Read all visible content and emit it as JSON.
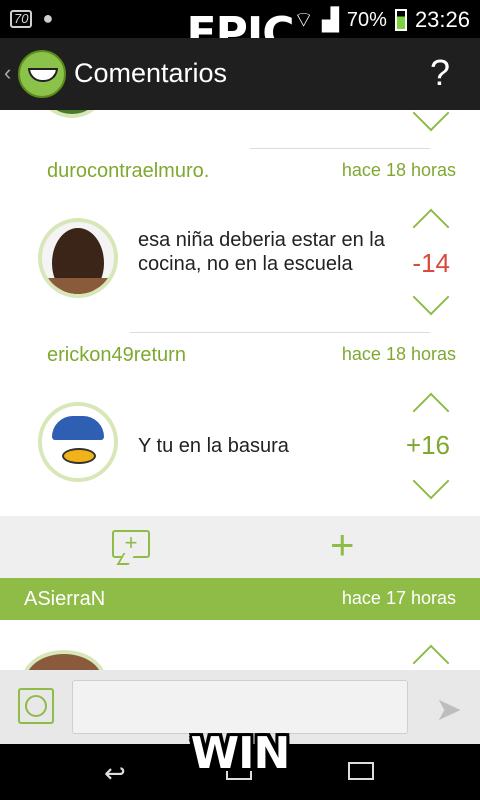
{
  "status_bar": {
    "badge": "70",
    "battery_percent": "70%",
    "time": "23:26"
  },
  "meme": {
    "top_text": "EPIC",
    "bottom_text": "WIN"
  },
  "action_bar": {
    "back_glyph": "‹",
    "title": "Comentarios",
    "help_glyph": "?"
  },
  "comments": [
    {
      "user": "durocontraelmuro.",
      "time": "hace 18 horas",
      "text": "esa niña deberia estar en la cocina, no en la escuela",
      "score": "-14",
      "avatar": "man-photo-avatar"
    },
    {
      "user": "erickon49return",
      "time": "hace 18 horas",
      "text": "Y tu en la basura",
      "score": "+16",
      "avatar": "duck-meme-avatar"
    }
  ],
  "thread_toolbar": {
    "comment_icon": "comment-add-icon",
    "add_icon": "plus-icon"
  },
  "next_thread": {
    "user": "ASierraN",
    "time": "hace 17 horas"
  },
  "input_bar": {
    "placeholder": "",
    "emoji_icon": "smiley-icon",
    "send_icon": "send-icon"
  },
  "colors": {
    "accent": "#8fbc47",
    "negative": "#d94a3d",
    "positive": "#7fa830",
    "action_bar": "#1f1f1f"
  }
}
